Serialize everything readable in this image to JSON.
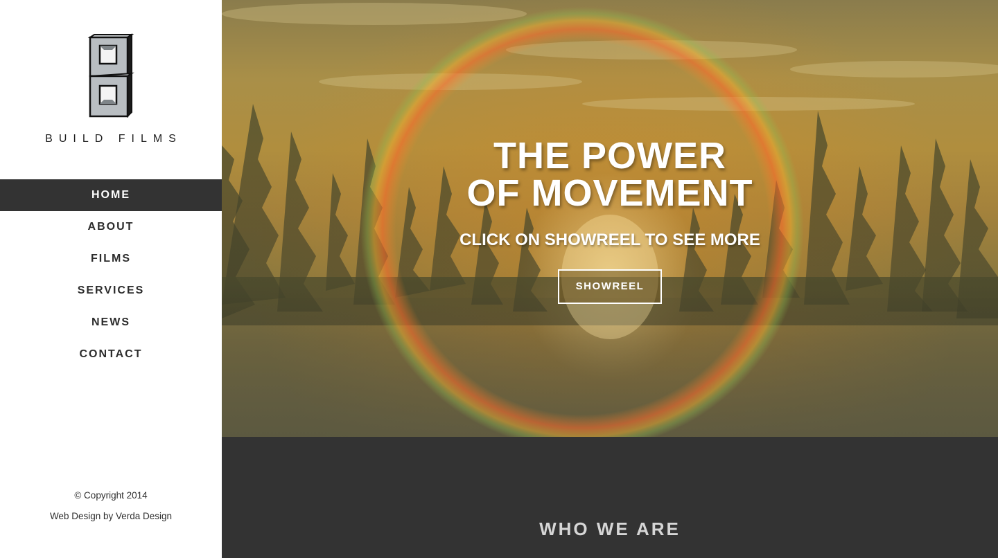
{
  "brand": {
    "name": "BUILD FILMS",
    "logo_icon": "stacked-cubes-logo"
  },
  "nav": {
    "items": [
      {
        "label": "HOME",
        "active": true
      },
      {
        "label": "ABOUT",
        "active": false
      },
      {
        "label": "FILMS",
        "active": false
      },
      {
        "label": "SERVICES",
        "active": false
      },
      {
        "label": "NEWS",
        "active": false
      },
      {
        "label": "CONTACT",
        "active": false
      }
    ]
  },
  "footer": {
    "copyright": "© Copyright 2014",
    "credit": "Web Design by Verda Design"
  },
  "hero": {
    "title_line1": "THE POWER",
    "title_line2": "OF MOVEMENT",
    "subtitle": "CLICK ON SHOWREEL TO SEE MORE",
    "button_label": "SHOWREEL"
  },
  "who": {
    "title": "WHO WE ARE"
  },
  "colors": {
    "sidebar_bg": "#ffffff",
    "nav_active_bg": "#333333",
    "section_dark_bg": "#333333",
    "hero_tint": "#a98f48"
  }
}
